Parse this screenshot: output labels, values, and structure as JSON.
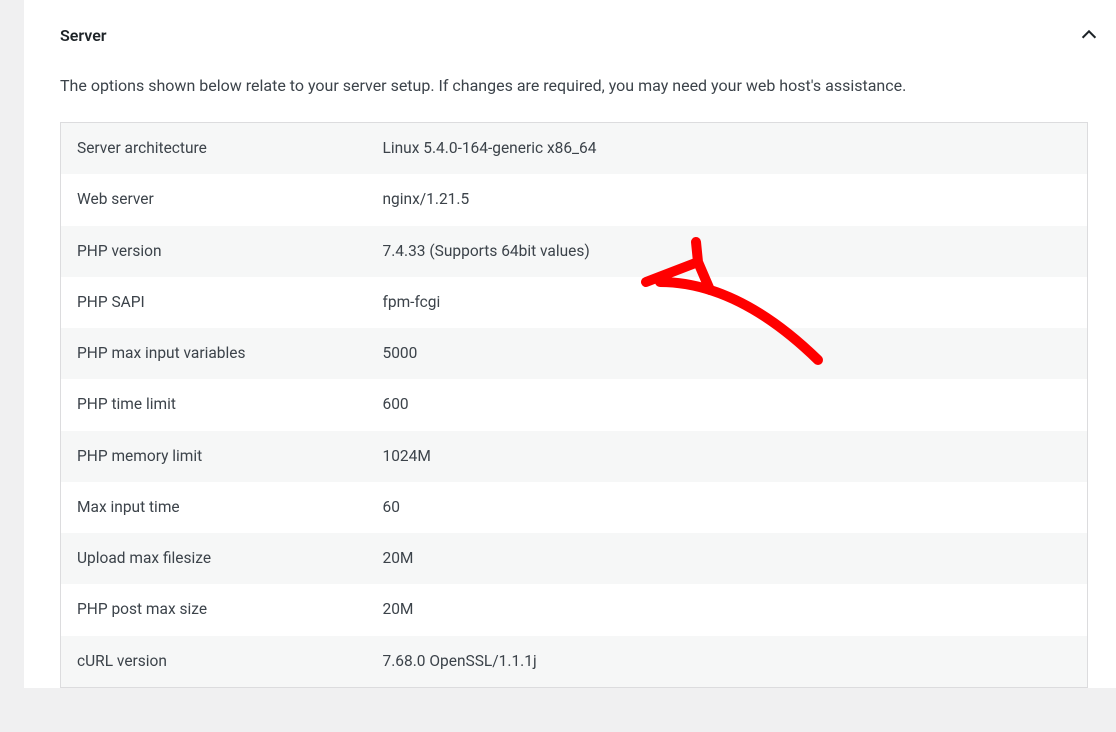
{
  "panel": {
    "title": "Server",
    "description": "The options shown below relate to your server setup. If changes are required, you may need your web host's assistance."
  },
  "rows": [
    {
      "label": "Server architecture",
      "value": "Linux 5.4.0-164-generic x86_64"
    },
    {
      "label": "Web server",
      "value": "nginx/1.21.5"
    },
    {
      "label": "PHP version",
      "value": "7.4.33 (Supports 64bit values)"
    },
    {
      "label": "PHP SAPI",
      "value": "fpm-fcgi"
    },
    {
      "label": "PHP max input variables",
      "value": "5000"
    },
    {
      "label": "PHP time limit",
      "value": "600"
    },
    {
      "label": "PHP memory limit",
      "value": "1024M"
    },
    {
      "label": "Max input time",
      "value": "60"
    },
    {
      "label": "Upload max filesize",
      "value": "20M"
    },
    {
      "label": "PHP post max size",
      "value": "20M"
    },
    {
      "label": "cURL version",
      "value": "7.68.0 OpenSSL/1.1.1j"
    }
  ]
}
